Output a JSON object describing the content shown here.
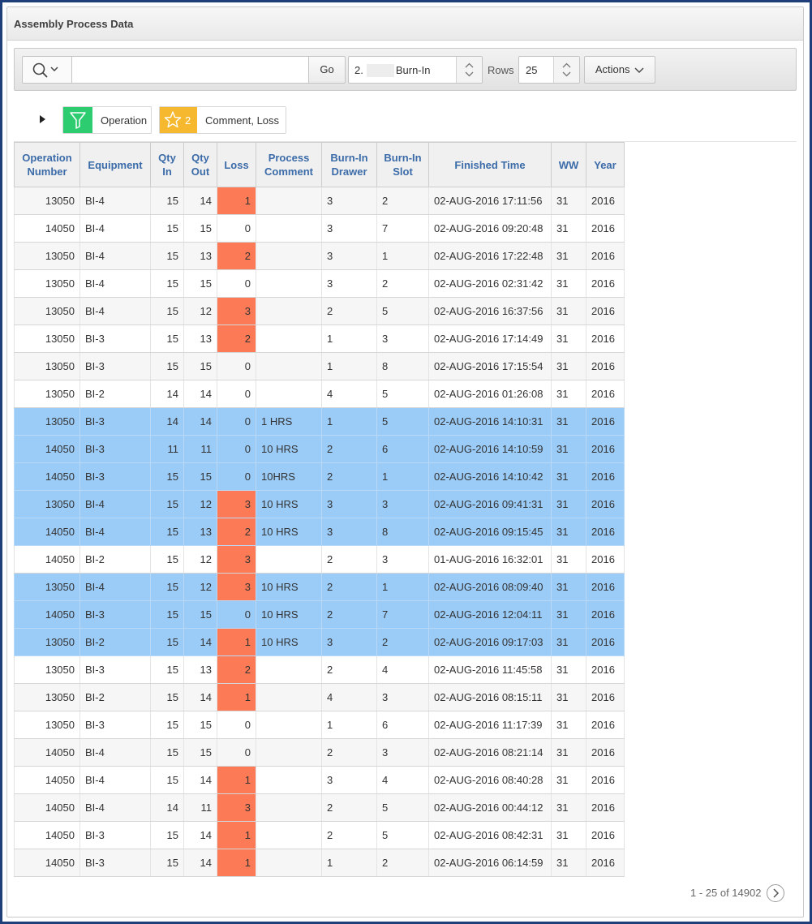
{
  "region": {
    "title": "Assembly Process Data"
  },
  "toolbar": {
    "search_value": "",
    "go_label": "Go",
    "report_prefix": "2.",
    "report_label": "Burn-In",
    "rows_label": "Rows",
    "rows_value": "25",
    "actions_label": "Actions"
  },
  "filters": {
    "filter1_label": "Operation",
    "filter2_count": "2",
    "filter2_label": "Comment, Loss"
  },
  "table": {
    "headers": {
      "op": "Operation Number",
      "equip": "Equipment",
      "qtyin": "Qty In",
      "qtyout": "Qty Out",
      "loss": "Loss",
      "comment": "Process Comment",
      "drawer": "Burn-In Drawer",
      "slot": "Burn-In Slot",
      "finished": "Finished Time",
      "ww": "WW",
      "year": "Year"
    },
    "rows": [
      [
        "13050",
        "BI-4",
        "15",
        "14",
        "1",
        "",
        "3",
        "2",
        "02-AUG-2016 17:11:56",
        "31",
        "2016"
      ],
      [
        "14050",
        "BI-4",
        "15",
        "15",
        "0",
        "",
        "3",
        "7",
        "02-AUG-2016 09:20:48",
        "31",
        "2016"
      ],
      [
        "13050",
        "BI-4",
        "15",
        "13",
        "2",
        "",
        "3",
        "1",
        "02-AUG-2016 17:22:48",
        "31",
        "2016"
      ],
      [
        "13050",
        "BI-4",
        "15",
        "15",
        "0",
        "",
        "3",
        "2",
        "02-AUG-2016 02:31:42",
        "31",
        "2016"
      ],
      [
        "13050",
        "BI-4",
        "15",
        "12",
        "3",
        "",
        "2",
        "5",
        "02-AUG-2016 16:37:56",
        "31",
        "2016"
      ],
      [
        "13050",
        "BI-3",
        "15",
        "13",
        "2",
        "",
        "1",
        "3",
        "02-AUG-2016 17:14:49",
        "31",
        "2016"
      ],
      [
        "13050",
        "BI-3",
        "15",
        "15",
        "0",
        "",
        "1",
        "8",
        "02-AUG-2016 17:15:54",
        "31",
        "2016"
      ],
      [
        "13050",
        "BI-2",
        "14",
        "14",
        "0",
        "",
        "4",
        "5",
        "02-AUG-2016 01:26:08",
        "31",
        "2016"
      ],
      [
        "13050",
        "BI-3",
        "14",
        "14",
        "0",
        "1 HRS",
        "1",
        "5",
        "02-AUG-2016 14:10:31",
        "31",
        "2016"
      ],
      [
        "14050",
        "BI-3",
        "11",
        "11",
        "0",
        "10 HRS",
        "2",
        "6",
        "02-AUG-2016 14:10:59",
        "31",
        "2016"
      ],
      [
        "14050",
        "BI-3",
        "15",
        "15",
        "0",
        "10HRS",
        "2",
        "1",
        "02-AUG-2016 14:10:42",
        "31",
        "2016"
      ],
      [
        "13050",
        "BI-4",
        "15",
        "12",
        "3",
        "10 HRS",
        "3",
        "3",
        "02-AUG-2016 09:41:31",
        "31",
        "2016"
      ],
      [
        "14050",
        "BI-4",
        "15",
        "13",
        "2",
        "10 HRS",
        "3",
        "8",
        "02-AUG-2016 09:15:45",
        "31",
        "2016"
      ],
      [
        "14050",
        "BI-2",
        "15",
        "12",
        "3",
        "",
        "2",
        "3",
        "01-AUG-2016 16:32:01",
        "31",
        "2016"
      ],
      [
        "13050",
        "BI-4",
        "15",
        "12",
        "3",
        "10 HRS",
        "2",
        "1",
        "02-AUG-2016 08:09:40",
        "31",
        "2016"
      ],
      [
        "14050",
        "BI-3",
        "15",
        "15",
        "0",
        "10 HRS",
        "2",
        "7",
        "02-AUG-2016 12:04:11",
        "31",
        "2016"
      ],
      [
        "13050",
        "BI-2",
        "15",
        "14",
        "1",
        "10 HRS",
        "3",
        "2",
        "02-AUG-2016 09:17:03",
        "31",
        "2016"
      ],
      [
        "13050",
        "BI-3",
        "15",
        "13",
        "2",
        "",
        "2",
        "4",
        "02-AUG-2016 11:45:58",
        "31",
        "2016"
      ],
      [
        "13050",
        "BI-2",
        "15",
        "14",
        "1",
        "",
        "4",
        "3",
        "02-AUG-2016 08:15:11",
        "31",
        "2016"
      ],
      [
        "13050",
        "BI-3",
        "15",
        "15",
        "0",
        "",
        "1",
        "6",
        "02-AUG-2016 11:17:39",
        "31",
        "2016"
      ],
      [
        "14050",
        "BI-4",
        "15",
        "15",
        "0",
        "",
        "2",
        "3",
        "02-AUG-2016 08:21:14",
        "31",
        "2016"
      ],
      [
        "14050",
        "BI-4",
        "15",
        "14",
        "1",
        "",
        "3",
        "4",
        "02-AUG-2016 08:40:28",
        "31",
        "2016"
      ],
      [
        "14050",
        "BI-4",
        "14",
        "11",
        "3",
        "",
        "2",
        "5",
        "02-AUG-2016 00:44:12",
        "31",
        "2016"
      ],
      [
        "14050",
        "BI-3",
        "15",
        "14",
        "1",
        "",
        "2",
        "5",
        "02-AUG-2016 08:42:31",
        "31",
        "2016"
      ],
      [
        "14050",
        "BI-3",
        "15",
        "14",
        "1",
        "",
        "1",
        "2",
        "02-AUG-2016 06:14:59",
        "31",
        "2016"
      ]
    ]
  },
  "pagination": {
    "text": "1 - 25 of 14902"
  },
  "colors": {
    "highlight_row": "#9bcbf7",
    "loss_highlight": "#fc7a55",
    "header_text": "#3b6ba8",
    "filter_green": "#2ecc71",
    "filter_orange": "#f5b82e"
  }
}
